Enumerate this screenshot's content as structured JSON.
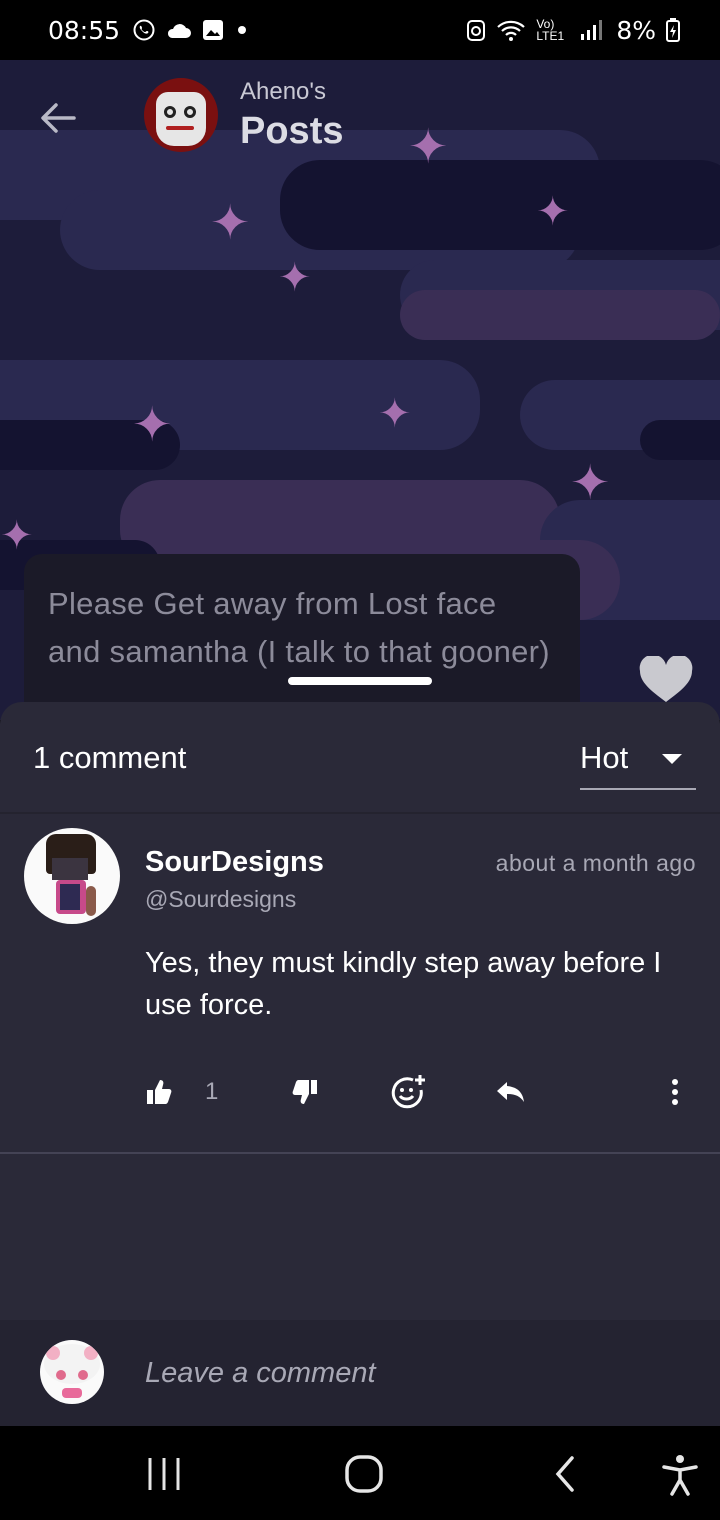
{
  "status_bar": {
    "time": "08:55",
    "battery": "8%",
    "network": "Vo) LTE1",
    "icons": [
      "whatsapp-icon",
      "cloud-icon",
      "gallery-icon",
      "dot-icon",
      "alarm-icon",
      "wifi-icon",
      "signal-icon",
      "battery-charging-icon"
    ]
  },
  "header": {
    "subtitle": "Aheno's",
    "title": "Posts"
  },
  "post": {
    "text": "Please Get away from Lost face and samantha (I talk to that gooner)"
  },
  "comments_sheet": {
    "count_label": "1 comment",
    "sort_value": "Hot",
    "comments": [
      {
        "author": "SourDesigns",
        "handle": "@Sourdesigns",
        "time": "about a month ago",
        "body": "Yes, they must kindly step away before I use force.",
        "likes": "1"
      }
    ]
  },
  "composer": {
    "placeholder": "Leave a comment"
  },
  "colors": {
    "sheet_bg": "#2a2938",
    "hero_bg": "#1d1c3a",
    "star": "#a56fae",
    "muted_text": "#a8a8b5"
  }
}
